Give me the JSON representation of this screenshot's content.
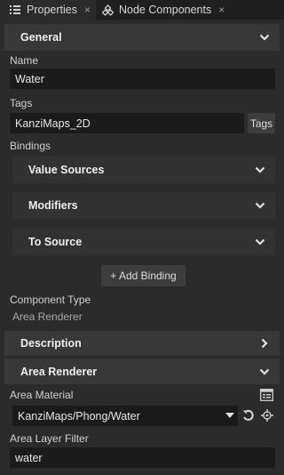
{
  "tabs": [
    {
      "label": "Properties",
      "close": "×",
      "active": true
    },
    {
      "label": "Node Components",
      "close": "×",
      "active": false
    }
  ],
  "general": {
    "title": "General",
    "name_label": "Name",
    "name_value": "Water",
    "tags_label": "Tags",
    "tags_value": "KanziMaps_2D",
    "tags_button": "Tags",
    "bindings_label": "Bindings",
    "value_sources": "Value Sources",
    "modifiers": "Modifiers",
    "to_source": "To Source",
    "add_binding": "+ Add Binding",
    "component_type_label": "Component Type",
    "component_type_value": "Area Renderer"
  },
  "description": {
    "title": "Description"
  },
  "area_renderer": {
    "title": "Area Renderer",
    "material_label": "Area Material",
    "material_value": "KanziMaps/Phong/Water",
    "layer_filter_label": "Area Layer Filter",
    "layer_filter_value": "water"
  },
  "colors": {
    "background": "#2b2b2b",
    "section_bar": "#383838",
    "field": "#1b1b1b",
    "tab_bar": "#1f1f1f"
  }
}
